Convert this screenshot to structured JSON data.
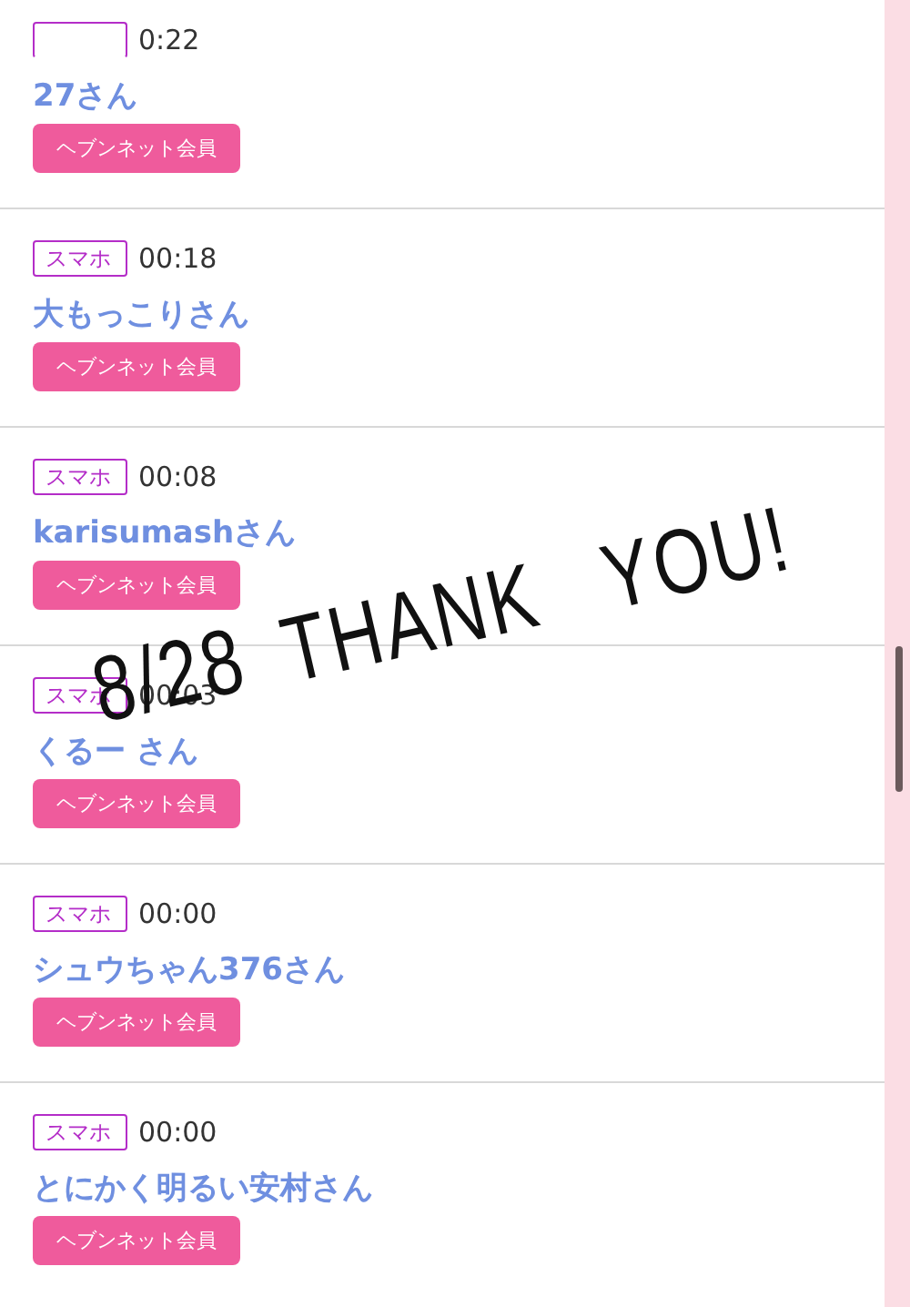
{
  "entries": [
    {
      "time": "0:22",
      "name": "27さん",
      "member": "ヘブンネット会員"
    },
    {
      "device": "スマホ",
      "time": "00:18",
      "name": "大もっこりさん",
      "member": "ヘブンネット会員"
    },
    {
      "device": "スマホ",
      "time": "00:08",
      "name": "karisumashさん",
      "member": "ヘブンネット会員"
    },
    {
      "device": "スマホ",
      "time": "00:03",
      "name": "くるー さん",
      "member": "ヘブンネット会員"
    },
    {
      "device": "スマホ",
      "time": "00:00",
      "name": "シュウちゃん376さん",
      "member": "ヘブンネット会員"
    },
    {
      "device": "スマホ",
      "time": "00:00",
      "name": "とにかく明るい安村さん",
      "member": "ヘブンネット会員"
    }
  ],
  "overlay": {
    "words": [
      "8/28",
      "THANK",
      "YOU!"
    ]
  }
}
